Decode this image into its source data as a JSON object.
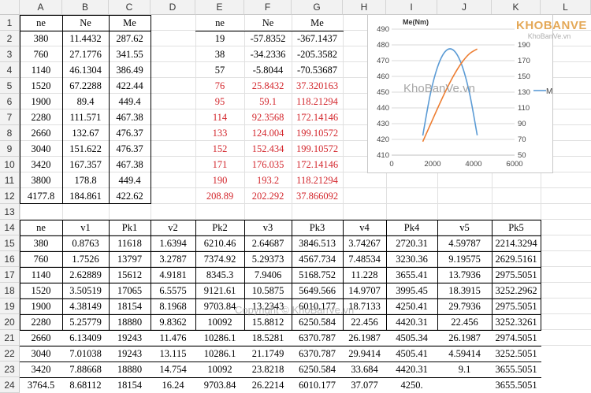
{
  "columns": [
    "A",
    "B",
    "C",
    "D",
    "E",
    "F",
    "G",
    "H",
    "I",
    "J",
    "K",
    "L"
  ],
  "rows": [
    "1",
    "2",
    "3",
    "4",
    "5",
    "6",
    "7",
    "8",
    "9",
    "10",
    "11",
    "12",
    "13",
    "14",
    "15",
    "16",
    "17",
    "18",
    "19",
    "20",
    "21",
    "22",
    "23",
    "24"
  ],
  "table1": {
    "headers": [
      "ne",
      "Ne",
      "Me"
    ],
    "rows": [
      [
        "380",
        "11.4432",
        "287.62"
      ],
      [
        "760",
        "27.1776",
        "341.55"
      ],
      [
        "1140",
        "46.1304",
        "386.49"
      ],
      [
        "1520",
        "67.2288",
        "422.44"
      ],
      [
        "1900",
        "89.4",
        "449.4"
      ],
      [
        "2280",
        "111.571",
        "467.38"
      ],
      [
        "2660",
        "132.67",
        "476.37"
      ],
      [
        "3040",
        "151.622",
        "476.37"
      ],
      [
        "3420",
        "167.357",
        "467.38"
      ],
      [
        "3800",
        "178.8",
        "449.4"
      ],
      [
        "4177.8",
        "184.861",
        "422.62"
      ]
    ]
  },
  "table2": {
    "headers": [
      "ne",
      "Ne",
      "Me"
    ],
    "rows": [
      [
        "19",
        "-57.8352",
        "-367.1437"
      ],
      [
        "38",
        "-34.2336",
        "-205.3582"
      ],
      [
        "57",
        "-5.8044",
        "-70.53687"
      ],
      [
        "76",
        "25.8432",
        "37.320163"
      ],
      [
        "95",
        "59.1",
        "118.21294"
      ],
      [
        "114",
        "92.3568",
        "172.14146"
      ],
      [
        "133",
        "124.004",
        "199.10572"
      ],
      [
        "152",
        "152.434",
        "199.10572"
      ],
      [
        "171",
        "176.035",
        "172.14146"
      ],
      [
        "190",
        "193.2",
        "118.21294"
      ],
      [
        "208.89",
        "202.292",
        "37.866092"
      ]
    ],
    "red_from_row": 3
  },
  "table3": {
    "headers": [
      "ne",
      "v1",
      "Pk1",
      "v2",
      "Pk2",
      "v3",
      "Pk3",
      "v4",
      "Pk4",
      "v5",
      "Pk5"
    ],
    "rows": [
      [
        "380",
        "0.8763",
        "11618",
        "1.6394",
        "6210.46",
        "2.64687",
        "3846.513",
        "3.74267",
        "2720.31",
        "4.59787",
        "2214.3294"
      ],
      [
        "760",
        "1.7526",
        "13797",
        "3.2787",
        "7374.92",
        "5.29373",
        "4567.734",
        "7.48534",
        "3230.36",
        "9.19575",
        "2629.5161"
      ],
      [
        "1140",
        "2.62889",
        "15612",
        "4.9181",
        "8345.3",
        "7.9406",
        "5168.752",
        "11.228",
        "3655.41",
        "13.7936",
        "2975.5051"
      ],
      [
        "1520",
        "3.50519",
        "17065",
        "6.5575",
        "9121.61",
        "10.5875",
        "5649.566",
        "14.9707",
        "3995.45",
        "18.3915",
        "3252.2962"
      ],
      [
        "1900",
        "4.38149",
        "18154",
        "8.1968",
        "9703.84",
        "13.2343",
        "6010.177",
        "18.7133",
        "4250.41",
        "29.7936",
        "2975.5051"
      ],
      [
        "2280",
        "5.25779",
        "18880",
        "9.8362",
        "10092",
        "15.8812",
        "6250.584",
        "22.456",
        "4420.31",
        "22.456",
        "3252.3261"
      ],
      [
        "2660",
        "6.13409",
        "19243",
        "11.476",
        "10286.1",
        "18.5281",
        "6370.787",
        "26.1987",
        "4505.34",
        "26.1987",
        "2974.5051"
      ],
      [
        "3040",
        "7.01038",
        "19243",
        "13.115",
        "10286.1",
        "21.1749",
        "6370.787",
        "29.9414",
        "4505.41",
        "4.59414",
        "3252.5051"
      ],
      [
        "3420",
        "7.88668",
        "18880",
        "14.754",
        "10092",
        "23.8218",
        "6250.584",
        "33.684",
        "4420.31",
        "9.1",
        "3655.5051"
      ],
      [
        "3764.5",
        "8.68112",
        "18154",
        "16.24",
        "9703.84",
        "26.2214",
        "6010.177",
        "37.077",
        "4250.",
        "",
        "3655.5051"
      ]
    ]
  },
  "chart_data": {
    "type": "line",
    "title": "Me(Nm)",
    "x_ticks": [
      "0",
      "2000",
      "4000",
      "6000"
    ],
    "y_left_ticks": [
      "410",
      "420",
      "430",
      "440",
      "450",
      "460",
      "470",
      "480",
      "490"
    ],
    "y_right_ticks": [
      "50",
      "70",
      "90",
      "110",
      "130",
      "150",
      "170",
      "190"
    ],
    "xlim": [
      0,
      6000
    ],
    "ylim_left": [
      410,
      490
    ],
    "ylim_right": [
      50,
      210
    ],
    "series": [
      {
        "name": "Me",
        "color": "#5b9bd5",
        "axis": "left",
        "x": [
          1520,
          1900,
          2280,
          2660,
          3040,
          3420,
          3800,
          4177.8
        ],
        "y": [
          422.44,
          449.4,
          467.38,
          476.37,
          476.37,
          467.38,
          449.4,
          422.62
        ]
      },
      {
        "name": "",
        "color": "#ed7d31",
        "axis": "right",
        "x": [
          1520,
          1900,
          2280,
          2660,
          3040,
          3420,
          3800,
          4177.8
        ],
        "y": [
          67.2288,
          89.4,
          111.571,
          132.67,
          151.622,
          167.357,
          178.8,
          184.861
        ]
      }
    ],
    "legend": "right"
  },
  "watermark": {
    "logo_main": "KHOBANVE",
    "logo_sub": "KhoBanVe.vn",
    "center": "KhoBanVe.vn",
    "footer": "Copyright © KhoBanVe.vn"
  }
}
